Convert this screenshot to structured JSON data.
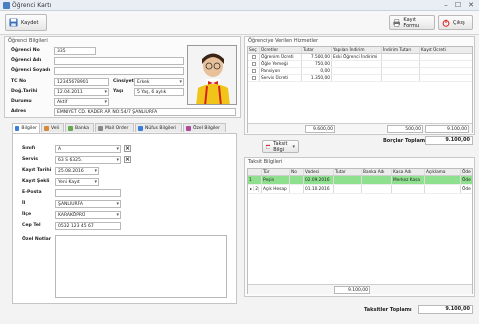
{
  "window": {
    "title": "Öğrenci Kartı",
    "minimize": "–",
    "maximize": "☐",
    "close": "✕"
  },
  "toolbar": {
    "save": "Kaydet",
    "form": "Kayıt Formu",
    "exit": "Çıkış"
  },
  "student": {
    "group_title": "Öğrenci Bilgileri",
    "labels": {
      "no": "Öğrenci No",
      "name": "Öğrenci Adı",
      "surname": "Öğrenci Soyadı",
      "tc": "TC No",
      "dob": "Doğ.Tarihi",
      "status": "Durumu",
      "address": "Adres",
      "gender": "Cinsiyet",
      "age": "Yaşı"
    },
    "values": {
      "no": "335",
      "name": "",
      "surname": "",
      "tc": "12345678901",
      "dob": "12.04.2011",
      "status": "Aktif",
      "address": "EMNIYET CD. KADER AP. NO:54/7 ŞANLIURFA",
      "gender": "Erkek",
      "age": "5 Yaş, 6 aylık"
    }
  },
  "tabs": [
    {
      "label": "Bilgiler",
      "color": "#3b7dd8"
    },
    {
      "label": "Veli",
      "color": "#d88a3b"
    },
    {
      "label": "Banka",
      "color": "#6aa84f"
    },
    {
      "label": "Mail Order",
      "color": "#888888"
    },
    {
      "label": "Nüfus Bilgileri",
      "color": "#3b7dd8"
    },
    {
      "label": "Özel Bilgiler",
      "color": "#b04a9c"
    }
  ],
  "info": {
    "labels": {
      "class": "Sınıfı",
      "service": "Servis",
      "reg_date": "Kayıt Tarihi",
      "reg_type": "Kayıt Şekli",
      "email": "E-Posta",
      "city": "İl",
      "district": "İlçe",
      "mobile": "Cep Tel",
      "notes": "Özel Notlar"
    },
    "values": {
      "class": "A",
      "service": "63 S 6325.",
      "reg_date": "25.08.2016",
      "reg_type": "Yeni Kayıt",
      "email": "",
      "city": "ŞANLIURFA",
      "district": "KARAKÖPRÜ",
      "mobile": "0532 123 45 67",
      "notes": ""
    }
  },
  "fees": {
    "group_title": "Öğrenciye Verilen Hizmetler",
    "headers": [
      "Seç",
      "Ücretler",
      "Tutar",
      "Yapılan İndirim",
      "İndirim Tutarı",
      "Kayıt Ücreti"
    ],
    "rows": [
      {
        "name": "Öğrenim Ücreti",
        "amount": "7.500,00",
        "discount": "Eski Öğrenci İndirimi",
        "disc_amount": "",
        "reg": ""
      },
      {
        "name": "Öğle Yemeği",
        "amount": "750,00",
        "discount": "",
        "disc_amount": "",
        "reg": ""
      },
      {
        "name": "Pansiyon",
        "amount": "0,00",
        "discount": "",
        "disc_amount": "",
        "reg": ""
      },
      {
        "name": "Servis Ücreti",
        "amount": "1.350,00",
        "discount": "",
        "disc_amount": "",
        "reg": ""
      }
    ],
    "footer": {
      "amount": "9.600,00",
      "disc_amount": "500,00",
      "reg": "9.100,00"
    },
    "total_label": "Borçlar Toplamı",
    "total_value": "9.100,00"
  },
  "installments": {
    "button": "Taksit Bilgi",
    "group_title": "Taksit Bilgileri",
    "headers": [
      "Tür",
      "No",
      "Vadesi",
      "Tutar",
      "Banka Adı",
      "Kasa Adı",
      "Açıklama",
      "Öde"
    ],
    "rows": [
      {
        "idx": "1",
        "type": "Peşin",
        "no": "",
        "due": "02.09.2016",
        "amount": "",
        "bank": "",
        "cash": "Merkez Kasa",
        "desc": "",
        "paid": "Öde",
        "highlight": "#8ee08e"
      },
      {
        "idx": "2",
        "type": "Açık Hesap",
        "no": "",
        "due": "01.10.2016",
        "amount": "",
        "bank": "",
        "cash": "",
        "desc": "",
        "paid": "Öde",
        "highlight": ""
      }
    ],
    "footer_amount": "9.100,00",
    "total_label": "Taksitler Toplamı",
    "total_value": "9.100,00"
  }
}
